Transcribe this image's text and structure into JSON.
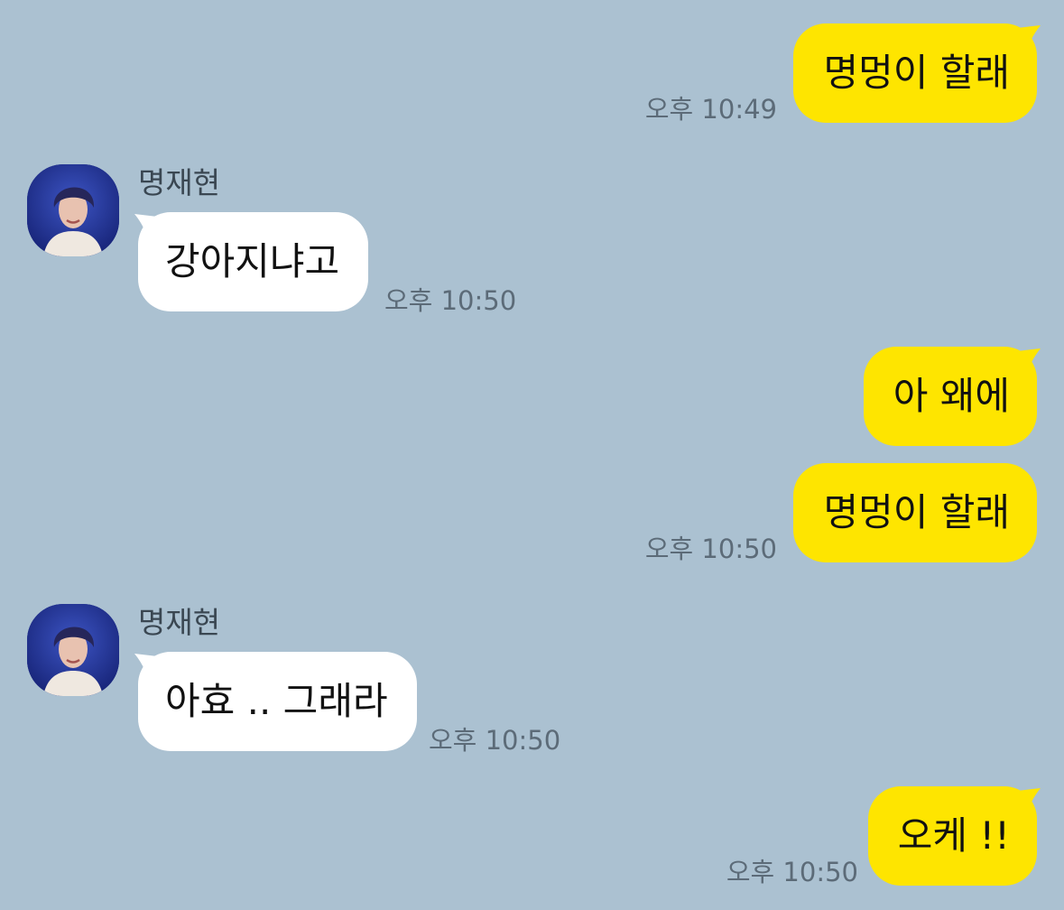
{
  "chat": {
    "messages": [
      {
        "sender": "me",
        "text": "명멍이 할래",
        "time": "오후 10:49"
      },
      {
        "sender": "명재현",
        "text": "강아지냐고",
        "time": "오후 10:50"
      },
      {
        "sender": "me",
        "text": "아 왜에"
      },
      {
        "sender": "me",
        "text": "명멍이 할래",
        "time": "오후 10:50"
      },
      {
        "sender": "명재현",
        "text": "아효 .. 그래라",
        "time": "오후 10:50"
      },
      {
        "sender": "me",
        "text": "오케 !!",
        "time": "오후 10:50"
      }
    ]
  },
  "colors": {
    "background": "#abc1d1",
    "my_bubble": "#fee500",
    "their_bubble": "#ffffff",
    "time_text": "#5c6b78"
  },
  "icons": {
    "avatar": "profile-photo"
  }
}
